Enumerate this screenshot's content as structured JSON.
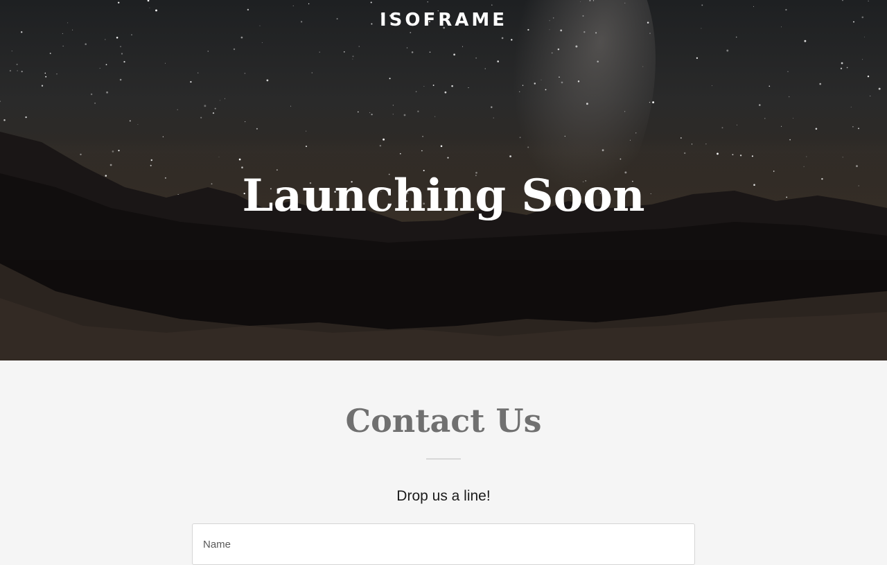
{
  "header": {
    "brand": "ISOFRAME"
  },
  "hero": {
    "title": "Launching Soon"
  },
  "contact": {
    "title": "Contact Us",
    "tagline": "Drop us a line!",
    "name_placeholder": "Name"
  },
  "colors": {
    "hero_text": "#ffffff",
    "contact_title": "#707070",
    "section_background": "#f5f5f5",
    "divider": "#d8d8d8"
  }
}
